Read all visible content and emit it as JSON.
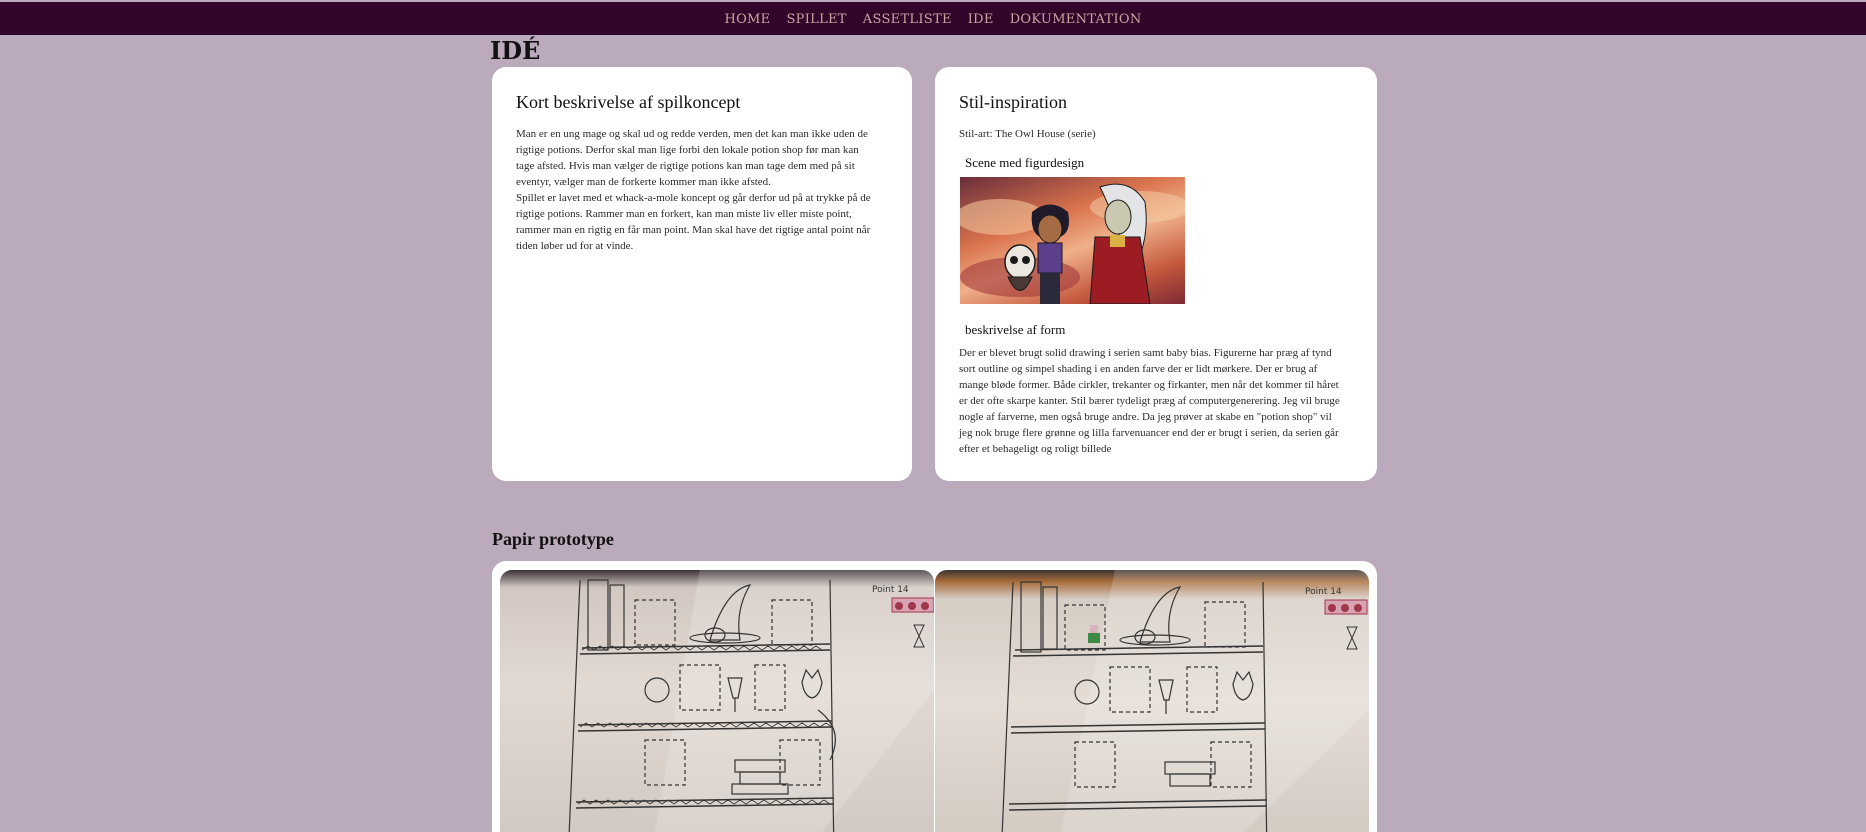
{
  "nav": {
    "items": [
      "HOME",
      "SPILLET",
      "ASSETLISTE",
      "IDE",
      "DOKUMENTATION"
    ]
  },
  "page": {
    "title": "IDÉ"
  },
  "concept": {
    "heading": "Kort beskrivelse af spilkoncept",
    "lines": [
      "Man er en ung mage og skal ud og redde verden, men det kan man ikke uden de",
      "rigtige potions. Derfor skal man lige forbi den lokale potion shop før man kan",
      "tage afsted. Hvis man vælger de rigtige potions kan man tage dem med på sit",
      "eventyr, vælger man de forkerte kommer man ikke afsted.",
      "Spillet er lavet med et whack-a-mole koncept og går derfor ud på at trykke på de",
      "rigtige potions. Rammer man en forkert, kan man miste liv eller miste point,",
      "rammer man en rigtig en får man point. Man skal have det rigtige antal point når",
      "tiden løber ud for at vinde."
    ]
  },
  "style": {
    "heading": "Stil-inspiration",
    "art_line": "Stil-art: The Owl House (serie)",
    "scene_heading": "Scene med figurdesign",
    "form_heading": "beskrivelse af form",
    "form_lines": [
      "Der er blevet brugt solid drawing i serien samt baby bias. Figurerne har præg af tynd",
      "sort outline og simpel shading i en anden farve der er lidt mørkere. Der er brug af",
      "mange bløde former. Både cirkler, trekanter og firkanter, men når det kommer til håret",
      "er der ofte skarpe kanter. Stil bærer tydeligt præg af computergenerering. Jeg vil bruge",
      "nogle af farverne, men også bruge andre. Da jeg prøver at skabe en \"potion shop\" vil",
      "jeg nok bruge flere grønne og lilla farvenuancer end der er brugt i serien, da serien går",
      "efter et behageligt og roligt billede"
    ]
  },
  "prototype": {
    "heading": "Papir prototype",
    "sketch_text_1": "Point 14",
    "sketch_text_2": "Point 14"
  },
  "colors": {
    "background": "#bba9bc",
    "nav_bar": "#31062a",
    "nav_text": "#c9a6a0",
    "card": "#ffffff"
  }
}
